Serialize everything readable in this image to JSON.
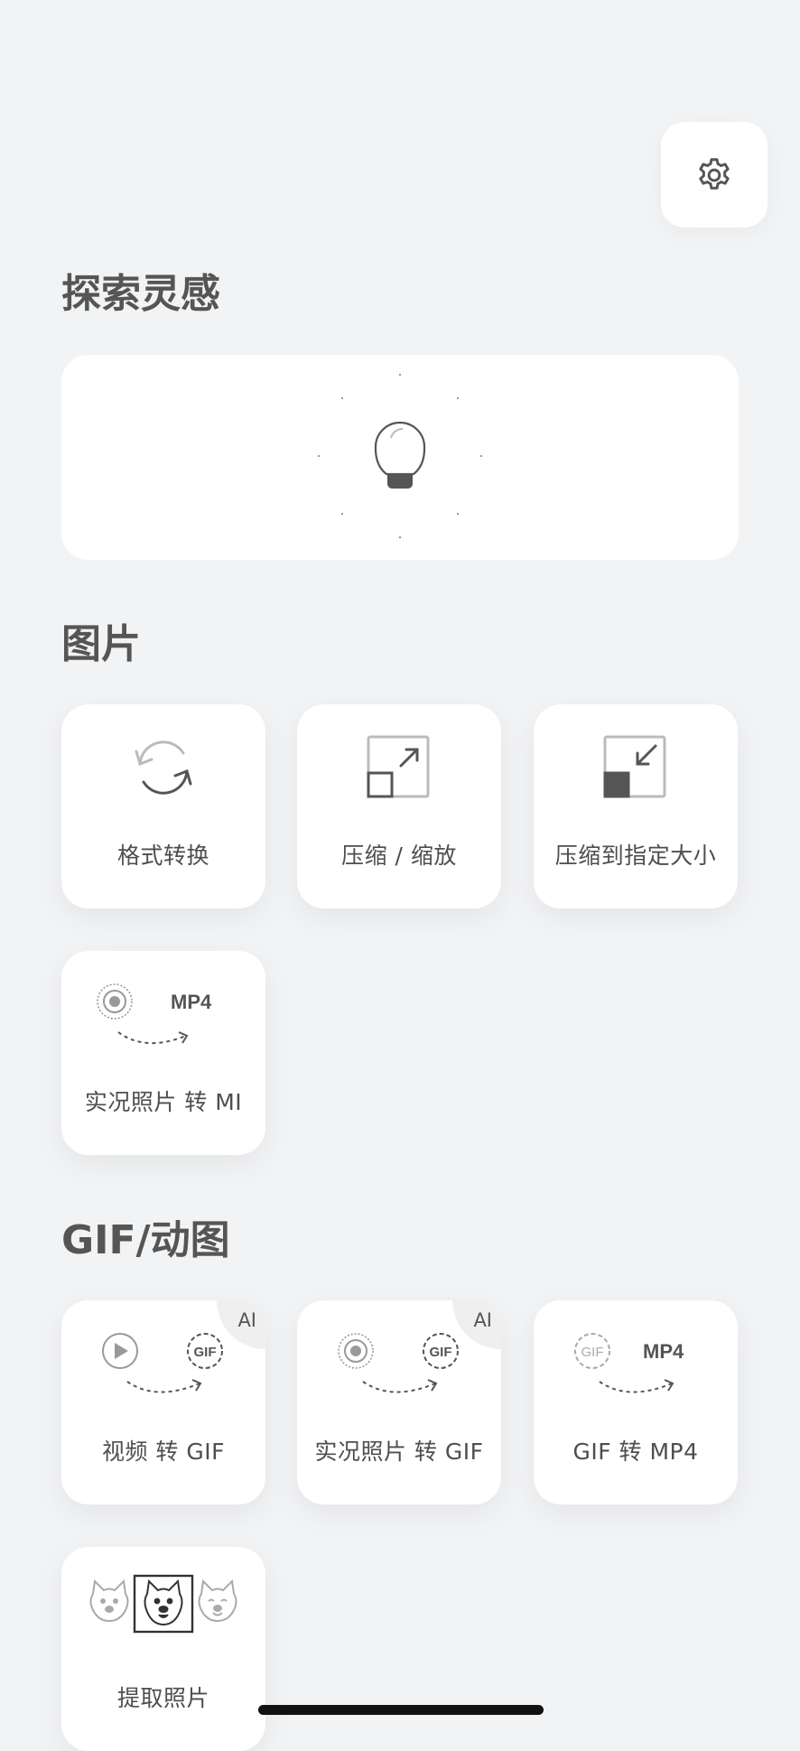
{
  "sections": {
    "inspiration": {
      "title": "探索灵感"
    },
    "images": {
      "title": "图片",
      "tiles": [
        {
          "label": "格式转换",
          "icon": "refresh-icon"
        },
        {
          "label": "压缩 / 缩放",
          "icon": "expand-icon"
        },
        {
          "label": "压缩到指定大小",
          "icon": "compress-icon"
        },
        {
          "label": "实况照片 转 MI",
          "icon": "live-to-mp4-icon",
          "icon_text": "MP4"
        }
      ]
    },
    "gif": {
      "title": "GIF/动图",
      "tiles": [
        {
          "label": "视频 转 GIF",
          "badge": "AI",
          "icon": "video-to-gif-icon",
          "icon_text": "GIF"
        },
        {
          "label": "实况照片 转 GIF",
          "badge": "AI",
          "icon": "live-to-gif-icon",
          "icon_text": "GIF"
        },
        {
          "label": "GIF 转 MP4",
          "icon": "gif-to-mp4-icon",
          "icon_text": "GIF",
          "icon_text2": "MP4"
        },
        {
          "label": "提取照片",
          "icon": "extract-frames-icon"
        }
      ]
    }
  },
  "icons": {
    "settings": "gear-icon",
    "inspiration": "lightbulb-icon"
  },
  "colors": {
    "background": "#f2f3f5",
    "card": "#ffffff",
    "text": "#4a4a4a",
    "icon": "#555555"
  }
}
